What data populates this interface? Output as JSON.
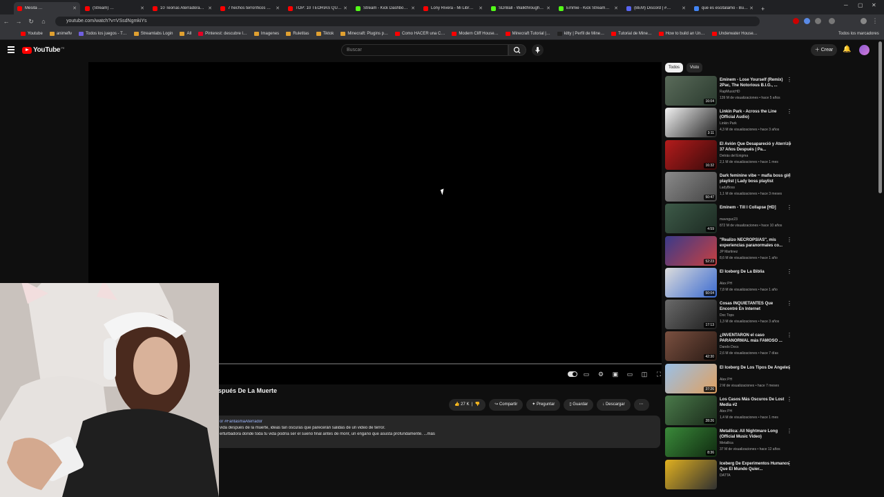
{
  "browser": {
    "tabs": [
      {
        "title": "Mesita …",
        "fav": "#ff0000"
      },
      {
        "title": "(Stream) …",
        "fav": "#ff0000"
      },
      {
        "title": "10 Teorías Aterradora…",
        "fav": "#ff0000"
      },
      {
        "title": "7 hechos terroríficos …",
        "fav": "#ff0000"
      },
      {
        "title": "TOP: 10 TEORÍAS QUE…",
        "fav": "#ff0000"
      },
      {
        "title": "Stream - Kick Dashbo…",
        "fav": "#53fc18"
      },
      {
        "title": "Lony Rivera - Mi Libr…",
        "fav": "#ff0000"
      },
      {
        "title": "SDrBall - Walkthrough…",
        "fav": "#53fc18"
      },
      {
        "title": "Emmie - Kick Stream…",
        "fav": "#53fc18"
      },
      {
        "title": "(BEM) Discord | #…",
        "fav": "#5865f2"
      },
      {
        "title": "que es escitalamo - Bu…",
        "fav": "#4285f4"
      }
    ],
    "url": "youtube.com/watch?v=VSsdNgmkiYs",
    "bookmarks": [
      "Youtube",
      "animeflv",
      "Todos los juegos - T…",
      "Streamlabs Login",
      "All",
      "Pinterest: descubre l…",
      "Imagenes",
      "Ruletitas",
      "Tiktok",
      "Minecraft: Plugins p…",
      "Como HACER una C…",
      "Modern Cliff House…",
      "Minecraft Tutorial |…",
      "kitty | Perfil de Mine…",
      "Tutorial de Mine…",
      "How to build an Un…",
      "Underwater House…"
    ],
    "all_bookmarks": "Todos los marcadores"
  },
  "youtube": {
    "logo": "YouTube",
    "region": "PE",
    "search_placeholder": "Buscar",
    "create_label": "Crear",
    "video_title": "spués De La Muerte",
    "actions": {
      "likes": "27 K",
      "share": "Compartir",
      "ask": "Preguntar",
      "save": "Guardar",
      "download": "Descargar"
    },
    "description": {
      "line1": "or #FantasmaAterrador",
      "line2": "vida después de la muerte, ideas tan oscuras que parecerán salidas de un video de terror.",
      "line3": "erturbadora donde toda tu vida podría ser el sueño final antes de morir, un engaño que asusta profundamente.",
      "more": "...más"
    },
    "chips": [
      "Todos",
      "Visto"
    ],
    "recommendations": [
      {
        "title": "Eminem - Lose Yourself (Remix) 2Pac, The Notorious B.I.G., ...",
        "channel": "RapMusicHD",
        "meta": "139 M de visualizaciones • hace 5 años",
        "duration": "16:04",
        "c1": "#5a6b5a",
        "c2": "#2a3a2e"
      },
      {
        "title": "Linkin Park - Across the Line (Official Audio)",
        "channel": "Linkin Park",
        "meta": "4,3 M de visualizaciones • hace 3 años",
        "duration": "3:11",
        "c1": "#f2f2f2",
        "c2": "#222222"
      },
      {
        "title": "El Avión Que Desapareció y Aterrizó 37 Años Después | Pa...",
        "channel": "Detrás del Enigma",
        "meta": "2,1 M de visualizaciones • hace 1 mes",
        "duration": "16:32",
        "c1": "#b31c1c",
        "c2": "#3a0a0a"
      },
      {
        "title": "Dark feminine vibe ~ mafia boss girl playlist | Lady boss playlist",
        "channel": "LadyBoss",
        "meta": "1,1 M de visualizaciones • hace 3 meses",
        "duration": "50:47",
        "c1": "#8a8a8a",
        "c2": "#444444"
      },
      {
        "title": "Eminem - Till I Collapse [HD]",
        "channel": "mavoguc23",
        "meta": "872 M de visualizaciones • hace 10 años",
        "duration": "4:59",
        "c1": "#3d5a48",
        "c2": "#1c2a22"
      },
      {
        "title": "\"Realizo NECROPSIAS\", mis experiencias paranormales co...",
        "channel": "JP Martinez",
        "meta": "8,6 M de visualizaciones • hace 1 año",
        "duration": "52:23",
        "c1": "#3a3a8a",
        "c2": "#c84040"
      },
      {
        "title": "El Iceberg De La Biblia",
        "channel": "Alex PH",
        "meta": "7,8 M de visualizaciones • hace 1 año",
        "duration": "50:04",
        "c1": "#dcdcdc",
        "c2": "#3a6ad0"
      },
      {
        "title": "Cosas INQUIETANTES Que Encontré En Internet",
        "channel": "Doc Tops",
        "meta": "1,3 M de visualizaciones • hace 3 años",
        "duration": "17:13",
        "c1": "#6a6a6a",
        "c2": "#1e1e1e"
      },
      {
        "title": "¿INVENTARON el caso PARANORMAL más FAMOSO ...",
        "channel": "Dando Docs",
        "meta": "2,6 M de visualizaciones • hace 7 días",
        "duration": "42:30",
        "c1": "#7a5040",
        "c2": "#2a1a14"
      },
      {
        "title": "El Iceberg De Los Tipos De Ángeles",
        "channel": "Alex PH",
        "meta": "2 M de visualizaciones • hace 7 meses",
        "duration": "37:26",
        "c1": "#9ac0e6",
        "c2": "#e0a060"
      },
      {
        "title": "Los Casos Más Oscuros De Lost Media #2",
        "channel": "Alex PH",
        "meta": "1,4 M de visualizaciones • hace 1 mes",
        "duration": "28:26",
        "c1": "#4a7a4a",
        "c2": "#1a2a1a"
      },
      {
        "title": "Metallica: All Nightmare Long (Official Music Video)",
        "channel": "Metallica",
        "meta": "37 M de visualizaciones • hace 12 años",
        "duration": "8:36",
        "c1": "#3a8a3a",
        "c2": "#102a10"
      },
      {
        "title": "Iceberg De Experimentos Humanos Que El Mundo Quier...",
        "channel": "DATTA",
        "meta": "",
        "duration": "",
        "c1": "#e0b020",
        "c2": "#303030"
      }
    ]
  }
}
